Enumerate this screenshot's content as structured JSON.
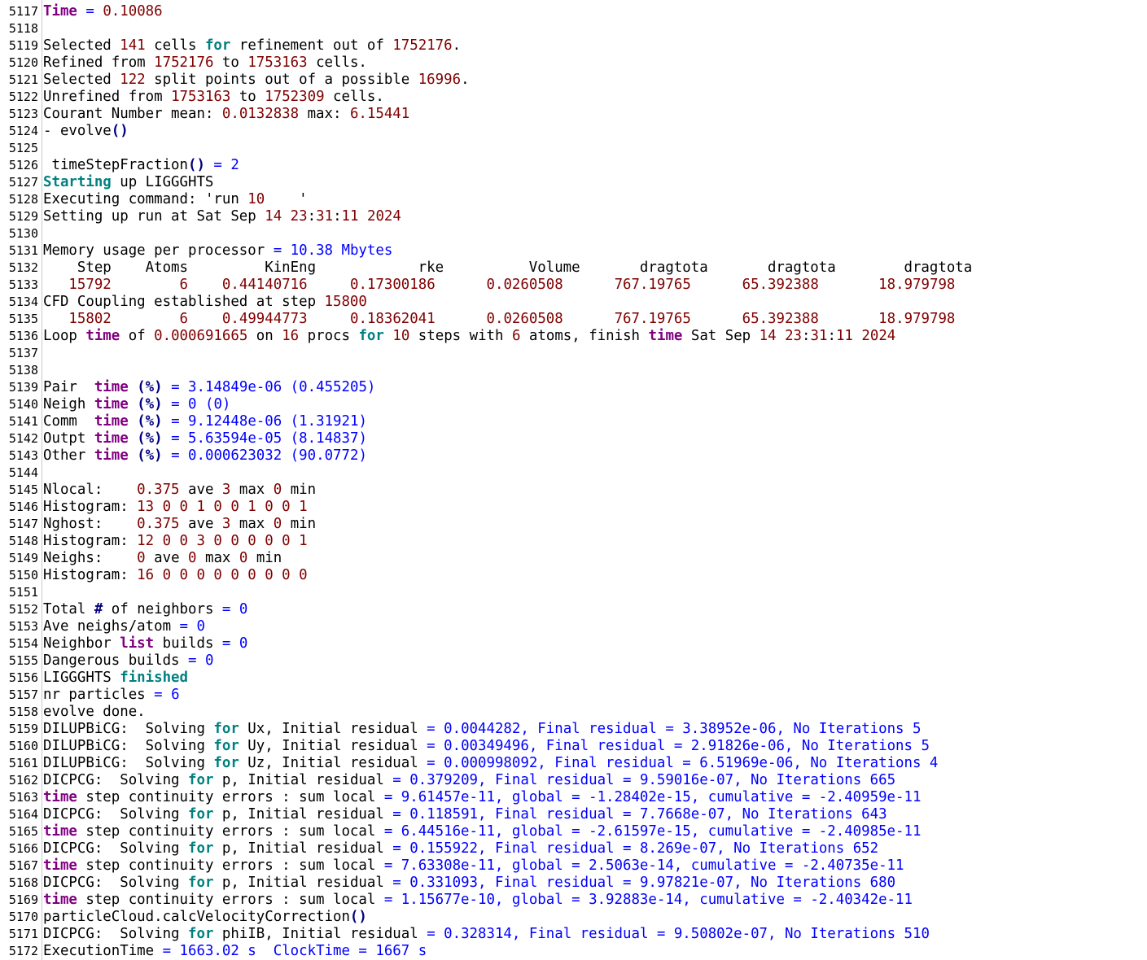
{
  "colors": {
    "text": "#000000",
    "keyword": "#008080",
    "keyword2": "#800080",
    "number": "#800000",
    "operator": "#0000ff",
    "blue": "#0000ff",
    "paren": "#000080",
    "gutter_border": "#c8c8c8"
  },
  "lines": [
    {
      "n": "5117",
      "tokens": [
        [
          "kw2",
          "Time"
        ],
        [
          "op",
          " = "
        ],
        [
          "num",
          "0.10086"
        ]
      ]
    },
    {
      "n": "5118",
      "tokens": []
    },
    {
      "n": "5119",
      "tokens": [
        [
          "txt",
          "Selected "
        ],
        [
          "num",
          "141"
        ],
        [
          "txt",
          " cells "
        ],
        [
          "kw",
          "for"
        ],
        [
          "txt",
          " refinement out of "
        ],
        [
          "num",
          "1752176"
        ],
        [
          "txt",
          "."
        ]
      ]
    },
    {
      "n": "5120",
      "tokens": [
        [
          "txt",
          "Refined from "
        ],
        [
          "num",
          "1752176"
        ],
        [
          "txt",
          " to "
        ],
        [
          "num",
          "1753163"
        ],
        [
          "txt",
          " cells."
        ]
      ]
    },
    {
      "n": "5121",
      "tokens": [
        [
          "txt",
          "Selected "
        ],
        [
          "num",
          "122"
        ],
        [
          "txt",
          " split points out of a possible "
        ],
        [
          "num",
          "16996"
        ],
        [
          "txt",
          "."
        ]
      ]
    },
    {
      "n": "5122",
      "tokens": [
        [
          "txt",
          "Unrefined from "
        ],
        [
          "num",
          "1753163"
        ],
        [
          "txt",
          " to "
        ],
        [
          "num",
          "1752309"
        ],
        [
          "txt",
          " cells."
        ]
      ]
    },
    {
      "n": "5123",
      "tokens": [
        [
          "txt",
          "Courant Number mean: "
        ],
        [
          "num",
          "0.0132838"
        ],
        [
          "txt",
          " max: "
        ],
        [
          "num",
          "6.15441"
        ]
      ]
    },
    {
      "n": "5124",
      "tokens": [
        [
          "txt",
          "- evolve"
        ],
        [
          "pun",
          "()"
        ]
      ]
    },
    {
      "n": "5125",
      "tokens": []
    },
    {
      "n": "5126",
      "tokens": [
        [
          "txt",
          " timeStepFraction"
        ],
        [
          "pun",
          "()"
        ],
        [
          "op",
          " = "
        ],
        [
          "bl",
          "2"
        ]
      ]
    },
    {
      "n": "5127",
      "tokens": [
        [
          "kw",
          "Starting"
        ],
        [
          "txt",
          " up LIGGGHTS"
        ]
      ]
    },
    {
      "n": "5128",
      "tokens": [
        [
          "txt",
          "Executing command: "
        ],
        [
          "txt",
          "'run "
        ],
        [
          "num",
          "10"
        ],
        [
          "txt",
          "    '"
        ]
      ]
    },
    {
      "n": "5129",
      "tokens": [
        [
          "txt",
          "Setting up run at Sat Sep "
        ],
        [
          "num",
          "14"
        ],
        [
          "txt",
          " "
        ],
        [
          "num",
          "23"
        ],
        [
          "txt",
          ":"
        ],
        [
          "num",
          "31"
        ],
        [
          "txt",
          ":"
        ],
        [
          "num",
          "11"
        ],
        [
          "txt",
          " "
        ],
        [
          "num",
          "2024"
        ]
      ]
    },
    {
      "n": "5130",
      "tokens": []
    },
    {
      "n": "5131",
      "tokens": [
        [
          "txt",
          "Memory usage per processor "
        ],
        [
          "op",
          "="
        ],
        [
          "bl",
          " 10.38 Mbytes"
        ]
      ]
    },
    {
      "n": "5132",
      "tokens": [
        [
          "txt",
          "    Step    Atoms         KinEng            rke          Volume       dragtota       dragtota        dragtota"
        ]
      ]
    },
    {
      "n": "5133",
      "tokens": [
        [
          "txt",
          "   "
        ],
        [
          "num",
          "15792"
        ],
        [
          "txt",
          "        "
        ],
        [
          "num",
          "6"
        ],
        [
          "txt",
          "    "
        ],
        [
          "num",
          "0.44140716"
        ],
        [
          "txt",
          "     "
        ],
        [
          "num",
          "0.17300186"
        ],
        [
          "txt",
          "      "
        ],
        [
          "num",
          "0.0260508"
        ],
        [
          "txt",
          "      "
        ],
        [
          "num",
          "767.19765"
        ],
        [
          "txt",
          "      "
        ],
        [
          "num",
          "65.392388"
        ],
        [
          "txt",
          "       "
        ],
        [
          "num",
          "18.979798"
        ]
      ]
    },
    {
      "n": "5134",
      "tokens": [
        [
          "txt",
          "CFD Coupling established at step "
        ],
        [
          "num",
          "15800"
        ]
      ]
    },
    {
      "n": "5135",
      "tokens": [
        [
          "txt",
          "   "
        ],
        [
          "num",
          "15802"
        ],
        [
          "txt",
          "        "
        ],
        [
          "num",
          "6"
        ],
        [
          "txt",
          "    "
        ],
        [
          "num",
          "0.49944773"
        ],
        [
          "txt",
          "     "
        ],
        [
          "num",
          "0.18362041"
        ],
        [
          "txt",
          "      "
        ],
        [
          "num",
          "0.0260508"
        ],
        [
          "txt",
          "      "
        ],
        [
          "num",
          "767.19765"
        ],
        [
          "txt",
          "      "
        ],
        [
          "num",
          "65.392388"
        ],
        [
          "txt",
          "       "
        ],
        [
          "num",
          "18.979798"
        ]
      ]
    },
    {
      "n": "5136",
      "tokens": [
        [
          "txt",
          "Loop "
        ],
        [
          "kw2",
          "time"
        ],
        [
          "txt",
          " of "
        ],
        [
          "num",
          "0.000691665"
        ],
        [
          "txt",
          " on "
        ],
        [
          "num",
          "16"
        ],
        [
          "txt",
          " procs "
        ],
        [
          "kw",
          "for"
        ],
        [
          "txt",
          " "
        ],
        [
          "num",
          "10"
        ],
        [
          "txt",
          " steps with "
        ],
        [
          "num",
          "6"
        ],
        [
          "txt",
          " atoms, finish "
        ],
        [
          "kw2",
          "time"
        ],
        [
          "txt",
          " Sat Sep "
        ],
        [
          "num",
          "14"
        ],
        [
          "txt",
          " "
        ],
        [
          "num",
          "23"
        ],
        [
          "txt",
          ":"
        ],
        [
          "num",
          "31"
        ],
        [
          "txt",
          ":"
        ],
        [
          "num",
          "11"
        ],
        [
          "txt",
          " "
        ],
        [
          "num",
          "2024"
        ]
      ]
    },
    {
      "n": "5137",
      "tokens": []
    },
    {
      "n": "5138",
      "tokens": []
    },
    {
      "n": "5139",
      "tokens": [
        [
          "txt",
          "Pair  "
        ],
        [
          "kw2",
          "time"
        ],
        [
          "txt",
          " "
        ],
        [
          "pun",
          "(%)"
        ],
        [
          "op",
          " = "
        ],
        [
          "bl",
          "3.14849e-06 (0.455205)"
        ]
      ]
    },
    {
      "n": "5140",
      "tokens": [
        [
          "txt",
          "Neigh "
        ],
        [
          "kw2",
          "time"
        ],
        [
          "txt",
          " "
        ],
        [
          "pun",
          "(%)"
        ],
        [
          "op",
          " = "
        ],
        [
          "bl",
          "0 (0)"
        ]
      ]
    },
    {
      "n": "5141",
      "tokens": [
        [
          "txt",
          "Comm  "
        ],
        [
          "kw2",
          "time"
        ],
        [
          "txt",
          " "
        ],
        [
          "pun",
          "(%)"
        ],
        [
          "op",
          " = "
        ],
        [
          "bl",
          "9.12448e-06 (1.31921)"
        ]
      ]
    },
    {
      "n": "5142",
      "tokens": [
        [
          "txt",
          "Outpt "
        ],
        [
          "kw2",
          "time"
        ],
        [
          "txt",
          " "
        ],
        [
          "pun",
          "(%)"
        ],
        [
          "op",
          " = "
        ],
        [
          "bl",
          "5.63594e-05 (8.14837)"
        ]
      ]
    },
    {
      "n": "5143",
      "tokens": [
        [
          "txt",
          "Other "
        ],
        [
          "kw2",
          "time"
        ],
        [
          "txt",
          " "
        ],
        [
          "pun",
          "(%)"
        ],
        [
          "op",
          " = "
        ],
        [
          "bl",
          "0.000623032 (90.0772)"
        ]
      ]
    },
    {
      "n": "5144",
      "tokens": []
    },
    {
      "n": "5145",
      "tokens": [
        [
          "txt",
          "Nlocal:    "
        ],
        [
          "num",
          "0.375"
        ],
        [
          "txt",
          " ave "
        ],
        [
          "num",
          "3"
        ],
        [
          "txt",
          " max "
        ],
        [
          "num",
          "0"
        ],
        [
          "txt",
          " min"
        ]
      ]
    },
    {
      "n": "5146",
      "tokens": [
        [
          "txt",
          "Histogram: "
        ],
        [
          "num",
          "13 0 0 1 0 0 1 0 0 1"
        ]
      ]
    },
    {
      "n": "5147",
      "tokens": [
        [
          "txt",
          "Nghost:    "
        ],
        [
          "num",
          "0.375"
        ],
        [
          "txt",
          " ave "
        ],
        [
          "num",
          "3"
        ],
        [
          "txt",
          " max "
        ],
        [
          "num",
          "0"
        ],
        [
          "txt",
          " min"
        ]
      ]
    },
    {
      "n": "5148",
      "tokens": [
        [
          "txt",
          "Histogram: "
        ],
        [
          "num",
          "12 0 0 3 0 0 0 0 0 1"
        ]
      ]
    },
    {
      "n": "5149",
      "tokens": [
        [
          "txt",
          "Neighs:    "
        ],
        [
          "num",
          "0"
        ],
        [
          "txt",
          " ave "
        ],
        [
          "num",
          "0"
        ],
        [
          "txt",
          " max "
        ],
        [
          "num",
          "0"
        ],
        [
          "txt",
          " min"
        ]
      ]
    },
    {
      "n": "5150",
      "tokens": [
        [
          "txt",
          "Histogram: "
        ],
        [
          "num",
          "16 0 0 0 0 0 0 0 0 0"
        ]
      ]
    },
    {
      "n": "5151",
      "tokens": []
    },
    {
      "n": "5152",
      "tokens": [
        [
          "txt",
          "Total "
        ],
        [
          "pun",
          "#"
        ],
        [
          "txt",
          " of neighbors "
        ],
        [
          "op",
          "="
        ],
        [
          "bl",
          " 0"
        ]
      ]
    },
    {
      "n": "5153",
      "tokens": [
        [
          "txt",
          "Ave neighs/atom "
        ],
        [
          "op",
          "="
        ],
        [
          "bl",
          " 0"
        ]
      ]
    },
    {
      "n": "5154",
      "tokens": [
        [
          "txt",
          "Neighbor "
        ],
        [
          "kw2",
          "list"
        ],
        [
          "txt",
          " builds "
        ],
        [
          "op",
          "="
        ],
        [
          "bl",
          " 0"
        ]
      ]
    },
    {
      "n": "5155",
      "tokens": [
        [
          "txt",
          "Dangerous builds "
        ],
        [
          "op",
          "="
        ],
        [
          "bl",
          " 0"
        ]
      ]
    },
    {
      "n": "5156",
      "tokens": [
        [
          "txt",
          "LIGGGHTS "
        ],
        [
          "kw",
          "finished"
        ]
      ]
    },
    {
      "n": "5157",
      "tokens": [
        [
          "txt",
          "nr particles "
        ],
        [
          "op",
          "="
        ],
        [
          "bl",
          " 6"
        ]
      ]
    },
    {
      "n": "5158",
      "tokens": [
        [
          "txt",
          "evolve done."
        ]
      ]
    },
    {
      "n": "5159",
      "tokens": [
        [
          "txt",
          "DILUPBiCG:  Solving "
        ],
        [
          "kw",
          "for"
        ],
        [
          "txt",
          " Ux, Initial residual "
        ],
        [
          "op",
          "="
        ],
        [
          "bl",
          " 0.0044282, Final residual = 3.38952e-06, No Iterations 5"
        ]
      ]
    },
    {
      "n": "5160",
      "tokens": [
        [
          "txt",
          "DILUPBiCG:  Solving "
        ],
        [
          "kw",
          "for"
        ],
        [
          "txt",
          " Uy, Initial residual "
        ],
        [
          "op",
          "="
        ],
        [
          "bl",
          " 0.00349496, Final residual = 2.91826e-06, No Iterations 5"
        ]
      ]
    },
    {
      "n": "5161",
      "tokens": [
        [
          "txt",
          "DILUPBiCG:  Solving "
        ],
        [
          "kw",
          "for"
        ],
        [
          "txt",
          " Uz, Initial residual "
        ],
        [
          "op",
          "="
        ],
        [
          "bl",
          " 0.000998092, Final residual = 6.51969e-06, No Iterations 4"
        ]
      ]
    },
    {
      "n": "5162",
      "tokens": [
        [
          "txt",
          "DICPCG:  Solving "
        ],
        [
          "kw",
          "for"
        ],
        [
          "txt",
          " p, Initial residual "
        ],
        [
          "op",
          "="
        ],
        [
          "bl",
          " 0.379209, Final residual = 9.59016e-07, No Iterations 665"
        ]
      ]
    },
    {
      "n": "5163",
      "tokens": [
        [
          "kw2",
          "time"
        ],
        [
          "txt",
          " step continuity errors : sum local "
        ],
        [
          "op",
          "="
        ],
        [
          "bl",
          " 9.61457e-11, global = -1.28402e-15, cumulative = -2.40959e-11"
        ]
      ]
    },
    {
      "n": "5164",
      "tokens": [
        [
          "txt",
          "DICPCG:  Solving "
        ],
        [
          "kw",
          "for"
        ],
        [
          "txt",
          " p, Initial residual "
        ],
        [
          "op",
          "="
        ],
        [
          "bl",
          " 0.118591, Final residual = 7.7668e-07, No Iterations 643"
        ]
      ]
    },
    {
      "n": "5165",
      "tokens": [
        [
          "kw2",
          "time"
        ],
        [
          "txt",
          " step continuity errors : sum local "
        ],
        [
          "op",
          "="
        ],
        [
          "bl",
          " 6.44516e-11, global = -2.61597e-15, cumulative = -2.40985e-11"
        ]
      ]
    },
    {
      "n": "5166",
      "tokens": [
        [
          "txt",
          "DICPCG:  Solving "
        ],
        [
          "kw",
          "for"
        ],
        [
          "txt",
          " p, Initial residual "
        ],
        [
          "op",
          "="
        ],
        [
          "bl",
          " 0.155922, Final residual = 8.269e-07, No Iterations 652"
        ]
      ]
    },
    {
      "n": "5167",
      "tokens": [
        [
          "kw2",
          "time"
        ],
        [
          "txt",
          " step continuity errors : sum local "
        ],
        [
          "op",
          "="
        ],
        [
          "bl",
          " 7.63308e-11, global = 2.5063e-14, cumulative = -2.40735e-11"
        ]
      ]
    },
    {
      "n": "5168",
      "tokens": [
        [
          "txt",
          "DICPCG:  Solving "
        ],
        [
          "kw",
          "for"
        ],
        [
          "txt",
          " p, Initial residual "
        ],
        [
          "op",
          "="
        ],
        [
          "bl",
          " 0.331093, Final residual = 9.97821e-07, No Iterations 680"
        ]
      ]
    },
    {
      "n": "5169",
      "tokens": [
        [
          "kw2",
          "time"
        ],
        [
          "txt",
          " step continuity errors : sum local "
        ],
        [
          "op",
          "="
        ],
        [
          "bl",
          " 1.15677e-10, global = 3.92883e-14, cumulative = -2.40342e-11"
        ]
      ]
    },
    {
      "n": "5170",
      "tokens": [
        [
          "txt",
          "particleCloud.calcVelocityCorrection"
        ],
        [
          "pun",
          "()"
        ]
      ]
    },
    {
      "n": "5171",
      "tokens": [
        [
          "txt",
          "DICPCG:  Solving "
        ],
        [
          "kw",
          "for"
        ],
        [
          "txt",
          " phiIB, Initial residual "
        ],
        [
          "op",
          "="
        ],
        [
          "bl",
          " 0.328314, Final residual = 9.50802e-07, No Iterations 510"
        ]
      ]
    },
    {
      "n": "5172",
      "tokens": [
        [
          "txt",
          "ExecutionTime "
        ],
        [
          "op",
          "="
        ],
        [
          "bl",
          " 1663.02 s  ClockTime = 1667 s"
        ]
      ]
    }
  ]
}
